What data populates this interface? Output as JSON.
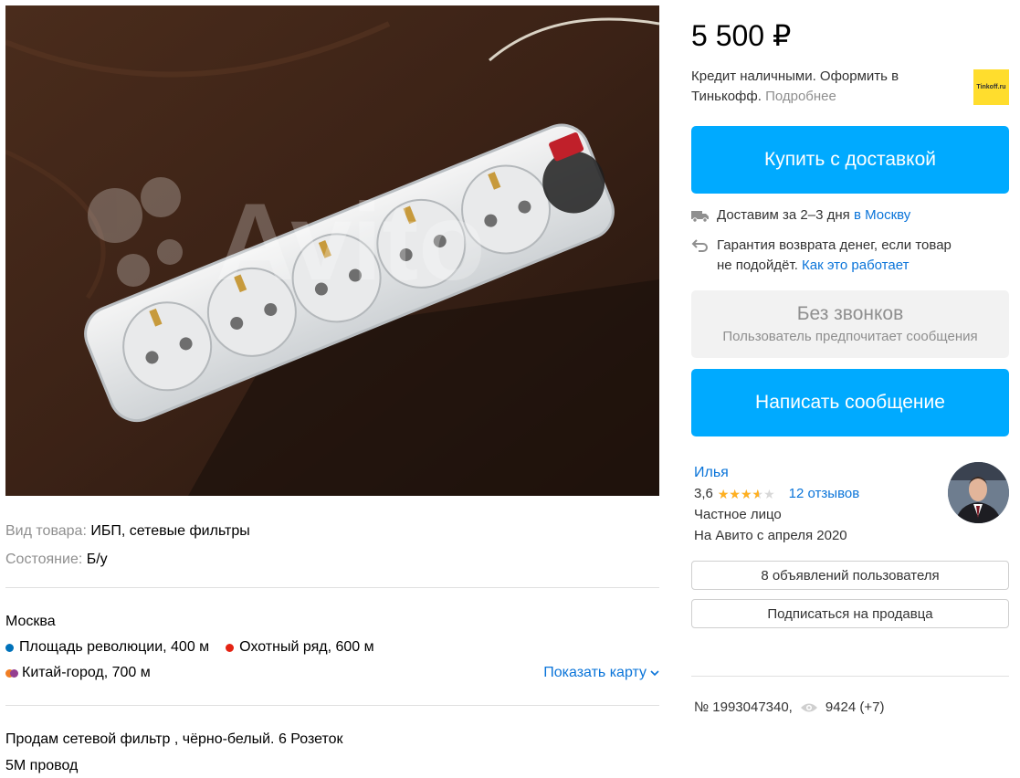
{
  "photo": {
    "watermark": "Avito"
  },
  "params": [
    {
      "label": "Вид товара:",
      "value": "ИБП, сетевые фильтры"
    },
    {
      "label": "Состояние:",
      "value": "Б/у"
    }
  ],
  "location": {
    "city": "Москва",
    "metro": [
      {
        "name": "Площадь революции, 400 м",
        "color": "#0072ba"
      },
      {
        "name": "Охотный ряд, 600 м",
        "color": "#e42313"
      },
      {
        "name": "Китай-город, 700 м",
        "colors": [
          "#f07e24",
          "#943e90"
        ]
      }
    ],
    "show_map": "Показать карту"
  },
  "description": {
    "line1": "Продам сетевой фильтр , чёрно-белый. 6 Розеток",
    "line2": "5М провод"
  },
  "price": "5 500 ₽",
  "credit": {
    "text": "Кредит наличными. Оформить в Тинькофф.",
    "more": "Подробнее",
    "logo_text": "Tinkoff.ru"
  },
  "buy_button": "Купить с доставкой",
  "delivery": {
    "text": "Доставим за 2–3 дня",
    "link": "в Москву"
  },
  "guarantee": {
    "text": "Гарантия возврата денег, если товар не подойдёт.",
    "link": "Как это работает"
  },
  "no_calls": {
    "title": "Без звонков",
    "subtitle": "Пользователь предпочитает сообщения"
  },
  "message_button": "Написать сообщение",
  "seller": {
    "name": "Илья",
    "rating": "3,6",
    "rating_value": 3.6,
    "reviews": "12 отзывов",
    "type": "Частное лицо",
    "since": "На Авито с апреля 2020"
  },
  "ads_button": "8 объявлений пользователя",
  "subscribe_button": "Подписаться на продавца",
  "ad_number": "№ 1993047340,",
  "views": "9424 (+7)",
  "colors": {
    "accent": "#00aaff",
    "link": "#0a74d9",
    "star": "#ffb021"
  }
}
